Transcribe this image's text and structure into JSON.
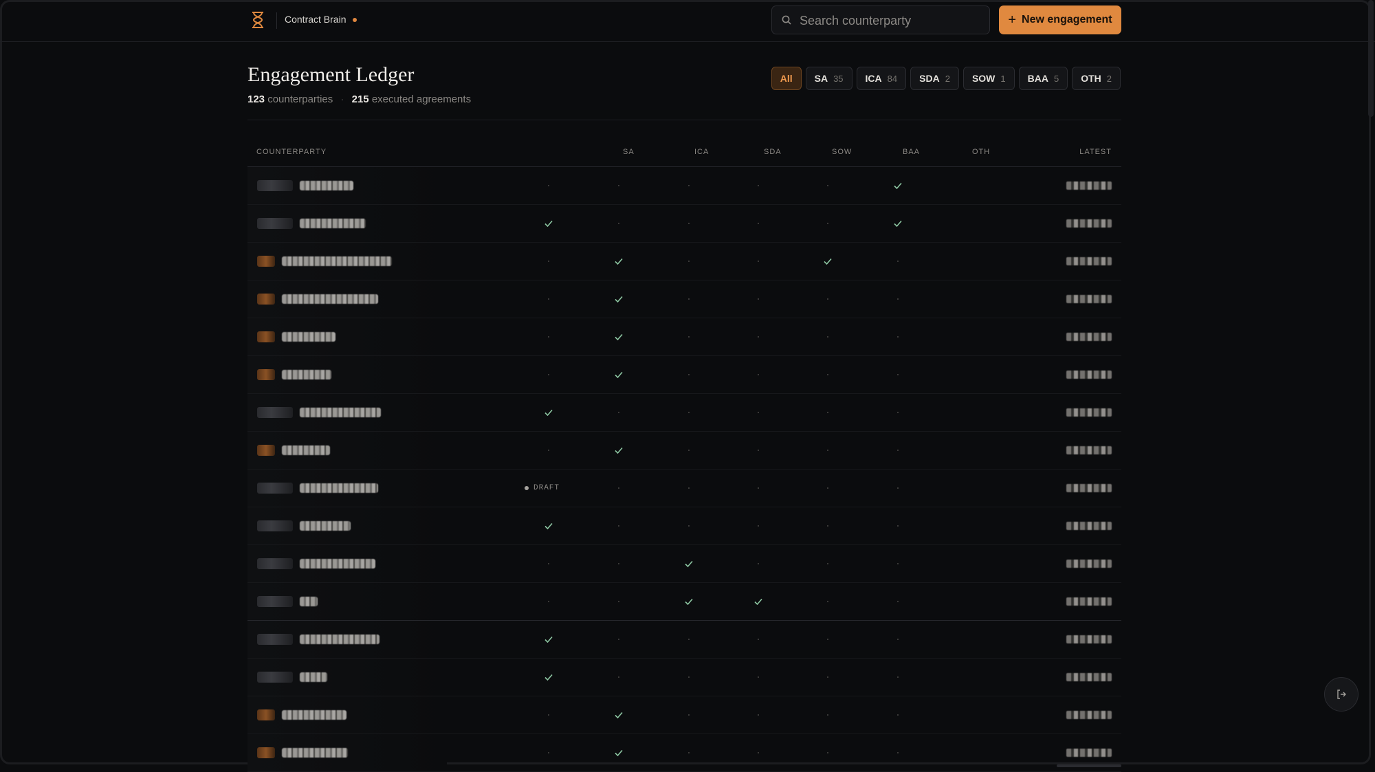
{
  "app": {
    "brand": "Contract Brain",
    "accent": "#e0893f"
  },
  "search": {
    "placeholder": "Search counterparty"
  },
  "actions": {
    "new_label": "New engagement"
  },
  "page": {
    "title": "Engagement Ledger",
    "counterparties_count": "123",
    "counterparties_label": "counterparties",
    "agreements_count": "215",
    "agreements_label": "executed agreements"
  },
  "filters": [
    {
      "label": "All",
      "count": "",
      "active": true
    },
    {
      "label": "SA",
      "count": "35"
    },
    {
      "label": "ICA",
      "count": "84"
    },
    {
      "label": "SDA",
      "count": "2"
    },
    {
      "label": "SOW",
      "count": "1"
    },
    {
      "label": "BAA",
      "count": "5"
    },
    {
      "label": "OTH",
      "count": "2"
    }
  ],
  "table": {
    "headers": {
      "counterparty": "COUNTERPARTY",
      "sa": "SA",
      "ica": "ICA",
      "sda": "SDA",
      "sow": "SOW",
      "baa": "BAA",
      "oth": "OTH",
      "latest": "LATEST"
    },
    "draft_label": "DRAFT",
    "rows": [
      {
        "badge": "gray",
        "name_width": 78,
        "cells": {
          "oth": "check"
        }
      },
      {
        "badge": "gray",
        "name_width": 96,
        "cells": {
          "sa": "check",
          "oth": "check"
        }
      },
      {
        "badge": "orange",
        "name_width": 160,
        "cells": {
          "ica": "check",
          "baa": "check"
        }
      },
      {
        "badge": "orange",
        "name_width": 140,
        "cells": {
          "ica": "check"
        }
      },
      {
        "badge": "orange",
        "name_width": 78,
        "cells": {
          "ica": "check"
        }
      },
      {
        "badge": "orange",
        "name_width": 72,
        "cells": {
          "ica": "check"
        }
      },
      {
        "badge": "gray",
        "name_width": 118,
        "cells": {
          "sa": "check"
        }
      },
      {
        "badge": "orange",
        "name_width": 70,
        "cells": {
          "ica": "check"
        }
      },
      {
        "badge": "gray",
        "name_width": 114,
        "cells": {
          "sa": "draft"
        }
      },
      {
        "badge": "gray",
        "name_width": 74,
        "cells": {
          "sa": "check"
        }
      },
      {
        "badge": "gray",
        "name_width": 110,
        "cells": {
          "sda": "check"
        }
      },
      {
        "badge": "gray",
        "name_width": 26,
        "cells": {
          "sda": "check",
          "sow": "check"
        }
      },
      {
        "badge": "gray",
        "name_width": 116,
        "cells": {
          "sa": "check"
        }
      },
      {
        "badge": "gray",
        "name_width": 40,
        "cells": {
          "sa": "check"
        }
      },
      {
        "badge": "orange",
        "name_width": 94,
        "cells": {
          "ica": "check"
        }
      },
      {
        "badge": "orange",
        "name_width": 96,
        "cells": {
          "ica": "check"
        }
      }
    ]
  },
  "icons": {
    "logo": "hourglass-icon",
    "search": "search-icon",
    "add": "plus-icon",
    "exit": "exit-icon",
    "check": "check-icon"
  }
}
